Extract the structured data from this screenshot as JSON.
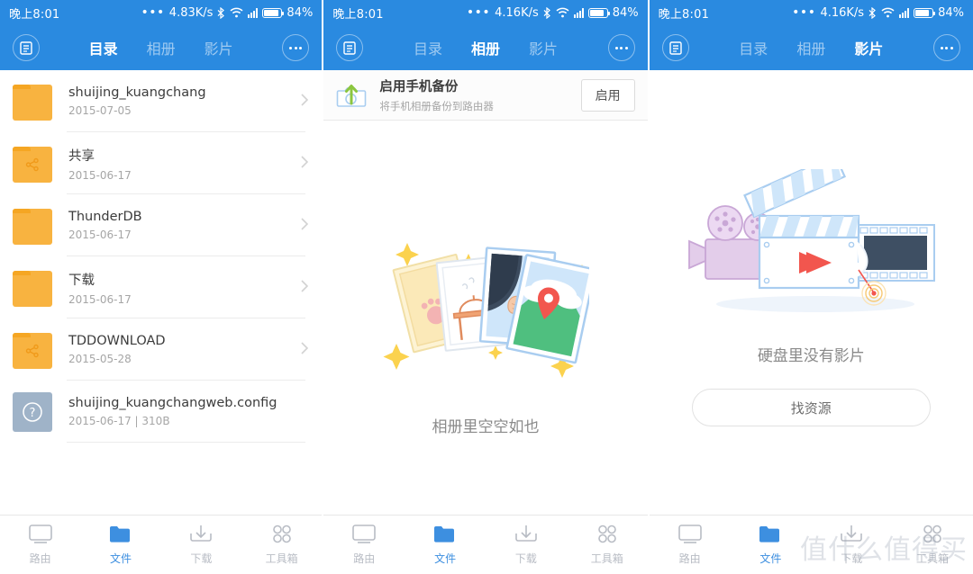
{
  "status_bar": {
    "time": "晚上8:01",
    "dots": "•••",
    "speed_left": "4.83K/s",
    "speed_mid": "4.16K/s",
    "speed_right": "4.16K/s",
    "battery_pct": "84%",
    "icons": [
      "bluetooth-icon",
      "wifi-icon",
      "signal-icon",
      "battery-icon"
    ]
  },
  "colors": {
    "brand_blue": "#2a8ae0",
    "accent_blue": "#3d8fe0",
    "folder_orange": "#f8b340",
    "doc_gray": "#9fb3c8",
    "text_primary": "#3c3c3c",
    "text_muted": "#a6a6a6"
  },
  "header": {
    "menu_icon": "document-list-icon",
    "more_icon": "more-dots-icon",
    "tabs": [
      {
        "label": "目录"
      },
      {
        "label": "相册"
      },
      {
        "label": "影片"
      }
    ],
    "active_index_panel1": 0,
    "active_index_panel2": 1,
    "active_index_panel3": 2
  },
  "panel1": {
    "files": [
      {
        "name": "shuijing_kuangchang",
        "meta": "2015-07-05",
        "icon": "folder-icon"
      },
      {
        "name": "共享",
        "meta": "2015-06-17",
        "icon": "folder-shared-icon"
      },
      {
        "name": "ThunderDB",
        "meta": "2015-06-17",
        "icon": "folder-icon"
      },
      {
        "name": "下载",
        "meta": "2015-06-17",
        "icon": "folder-icon"
      },
      {
        "name": "TDDOWNLOAD",
        "meta": "2015-05-28",
        "icon": "folder-shared-icon"
      },
      {
        "name": "shuijing_kuangchangweb.config",
        "meta": "2015-06-17 | 310B",
        "icon": "unknown-file-icon"
      }
    ]
  },
  "panel2": {
    "banner": {
      "icon": "camera-backup-icon",
      "title": "启用手机备份",
      "subtitle": "将手机相册备份到路由器",
      "button": "启用"
    },
    "empty": {
      "illustration": "photo-stack-illustration",
      "caption": "相册里空空如也"
    }
  },
  "panel3": {
    "empty": {
      "illustration": "clapperboard-film-illustration",
      "caption": "硬盘里没有影片",
      "button": "找资源"
    }
  },
  "bottom_nav": {
    "items": [
      {
        "label": "路由",
        "icon": "monitor-icon"
      },
      {
        "label": "文件",
        "icon": "folder-icon"
      },
      {
        "label": "下载",
        "icon": "download-icon"
      },
      {
        "label": "工具箱",
        "icon": "grid-dots-icon"
      }
    ],
    "active_index": 1
  },
  "watermark": {
    "text": "值什么值得买"
  }
}
